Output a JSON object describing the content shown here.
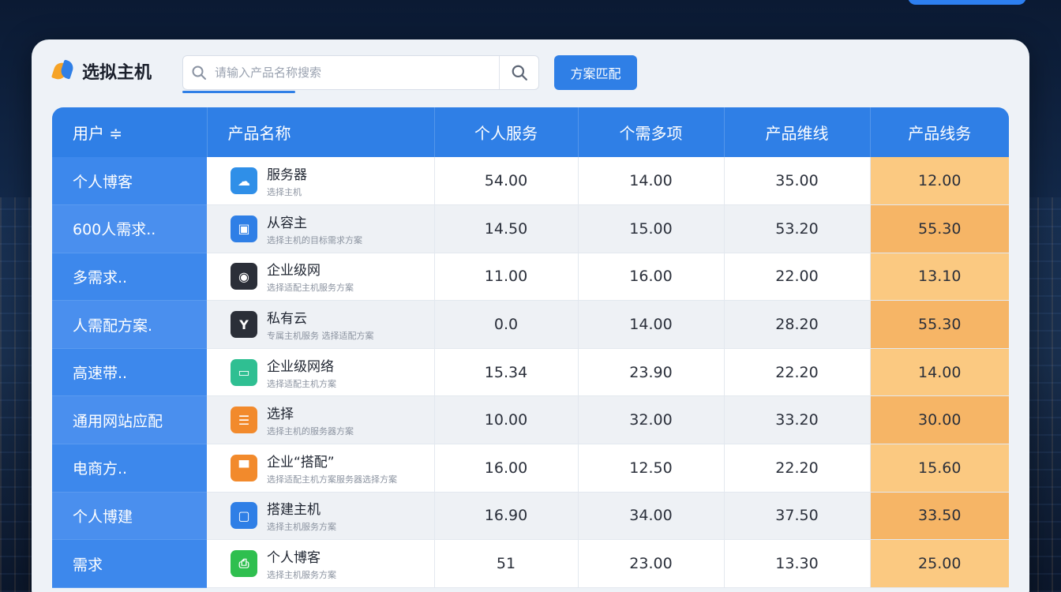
{
  "brand": {
    "name": "选拟主机"
  },
  "search": {
    "placeholder": "请输入产品名称搜索"
  },
  "action_button": {
    "label": "方案匹配"
  },
  "colors": {
    "accent": "#2f7fe6",
    "highlight": "#fbc981",
    "highlight_alt": "#f6b566",
    "user_column": "#3d88ec"
  },
  "table": {
    "headers": [
      "用户 ≑",
      "产品名称",
      "个人服务",
      "个需多项",
      "产品维线",
      "产品线务"
    ],
    "rows": [
      {
        "user": "个人博客",
        "product": "服务器",
        "sub": "选择主机",
        "icon": "cloud-icon",
        "icon_color": "#2f8fe8",
        "c1": "54.00",
        "c2": "14.00",
        "c3": "35.00",
        "c4": "12.00"
      },
      {
        "user": "600人需求..",
        "product": "从容主",
        "sub": "选择主机的目标需求方案",
        "icon": "box-icon",
        "icon_color": "#2f7fe6",
        "c1": "14.50",
        "c2": "15.00",
        "c3": "53.20",
        "c4": "55.30"
      },
      {
        "user": "多需求..",
        "product": "企业级网",
        "sub": "选择适配主机服务方案",
        "icon": "camera-icon",
        "icon_color": "#2b2f38",
        "c1": "11.00",
        "c2": "16.00",
        "c3": "22.00",
        "c4": "13.10"
      },
      {
        "user": "人需配方案.",
        "product": "私有云",
        "sub": "专属主机服务 选择适配方案",
        "icon": "plant-icon",
        "icon_color": "#2b2f38",
        "c1": "0.0",
        "c2": "14.00",
        "c3": "28.20",
        "c4": "55.30"
      },
      {
        "user": "高速带..",
        "product": "企业级网络",
        "sub": "选择适配主机方案",
        "icon": "display-icon",
        "icon_color": "#2fbf92",
        "c1": "15.34",
        "c2": "23.90",
        "c3": "22.20",
        "c4": "14.00"
      },
      {
        "user": "通用网站应配",
        "product": "选择",
        "sub": "选择主机的服务器方案",
        "icon": "server-icon",
        "icon_color": "#f28a2c",
        "c1": "10.00",
        "c2": "32.00",
        "c3": "33.20",
        "c4": "30.00"
      },
      {
        "user": "电商方..",
        "product": "企业“搭配”",
        "sub": "选择适配主机方案服务器选择方案",
        "icon": "monitor-icon",
        "icon_color": "#f28a2c",
        "c1": "16.00",
        "c2": "12.50",
        "c3": "22.20",
        "c4": "15.60"
      },
      {
        "user": "个人博建",
        "product": "搭建主机",
        "sub": "选择主机服务方案",
        "icon": "chat-icon",
        "icon_color": "#2f7fe6",
        "c1": "16.90",
        "c2": "34.00",
        "c3": "37.50",
        "c4": "33.50"
      },
      {
        "user": "需求",
        "product": "个人博客",
        "sub": "选择主机服务方案",
        "icon": "printer-icon",
        "icon_color": "#2fbf4f",
        "c1": "51",
        "c2": "23.00",
        "c3": "13.30",
        "c4": "25.00"
      }
    ]
  }
}
